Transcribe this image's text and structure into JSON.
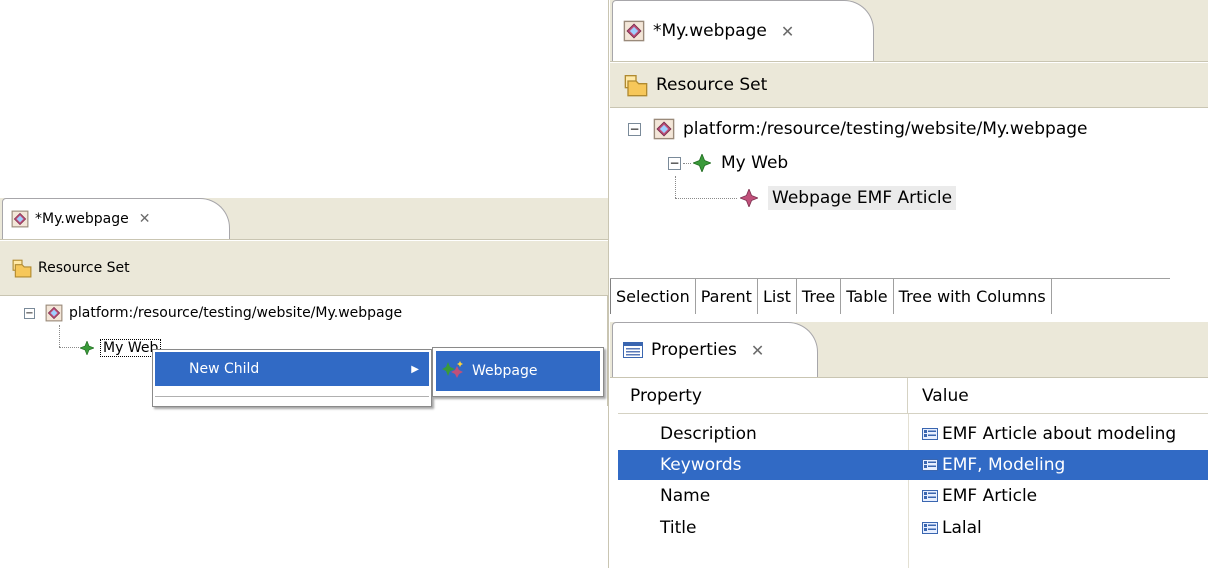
{
  "colors": {
    "tab_bg": "#ebe8d9",
    "selection": "#316ac5",
    "tree_node_green": "#3a9a3a",
    "tree_node_pink": "#b03060"
  },
  "left_editor": {
    "tab": {
      "title": "*My.webpage",
      "icon": "webpage-model-icon",
      "close_icon": "close-icon"
    },
    "toolbar": {
      "label": "Resource Set",
      "icon": "resource-set-icon"
    },
    "tree": {
      "root_label": "platform:/resource/testing/website/My.webpage",
      "root_icon": "webpage-model-icon",
      "child_label": "My Web",
      "child_icon": "web-node-icon"
    },
    "context_menu": {
      "item_label": "New Child",
      "submenu_arrow": "▶",
      "submenu_item_label": "Webpage",
      "submenu_item_icon": "new-webpage-icon"
    }
  },
  "right_editor": {
    "tab": {
      "title": "*My.webpage",
      "icon": "webpage-model-icon",
      "close_icon": "close-icon"
    },
    "toolbar": {
      "label": "Resource Set",
      "icon": "resource-set-icon"
    },
    "tree": {
      "root_label": "platform:/resource/testing/website/My.webpage",
      "child_label": "My Web",
      "grandchild_label": "Webpage EMF Article"
    },
    "bottom_tabs": [
      "Selection",
      "Parent",
      "List",
      "Tree",
      "Table",
      "Tree with Columns"
    ]
  },
  "properties": {
    "tab": {
      "title": "Properties",
      "icon": "properties-icon",
      "close_icon": "close-icon"
    },
    "columns": {
      "property": "Property",
      "value": "Value"
    },
    "rows": [
      {
        "property": "Description",
        "value": "EMF Article about modeling",
        "selected": false
      },
      {
        "property": "Keywords",
        "value": "EMF, Modeling",
        "selected": true
      },
      {
        "property": "Name",
        "value": "EMF Article",
        "selected": false
      },
      {
        "property": "Title",
        "value": "Lalal",
        "selected": false
      }
    ]
  }
}
